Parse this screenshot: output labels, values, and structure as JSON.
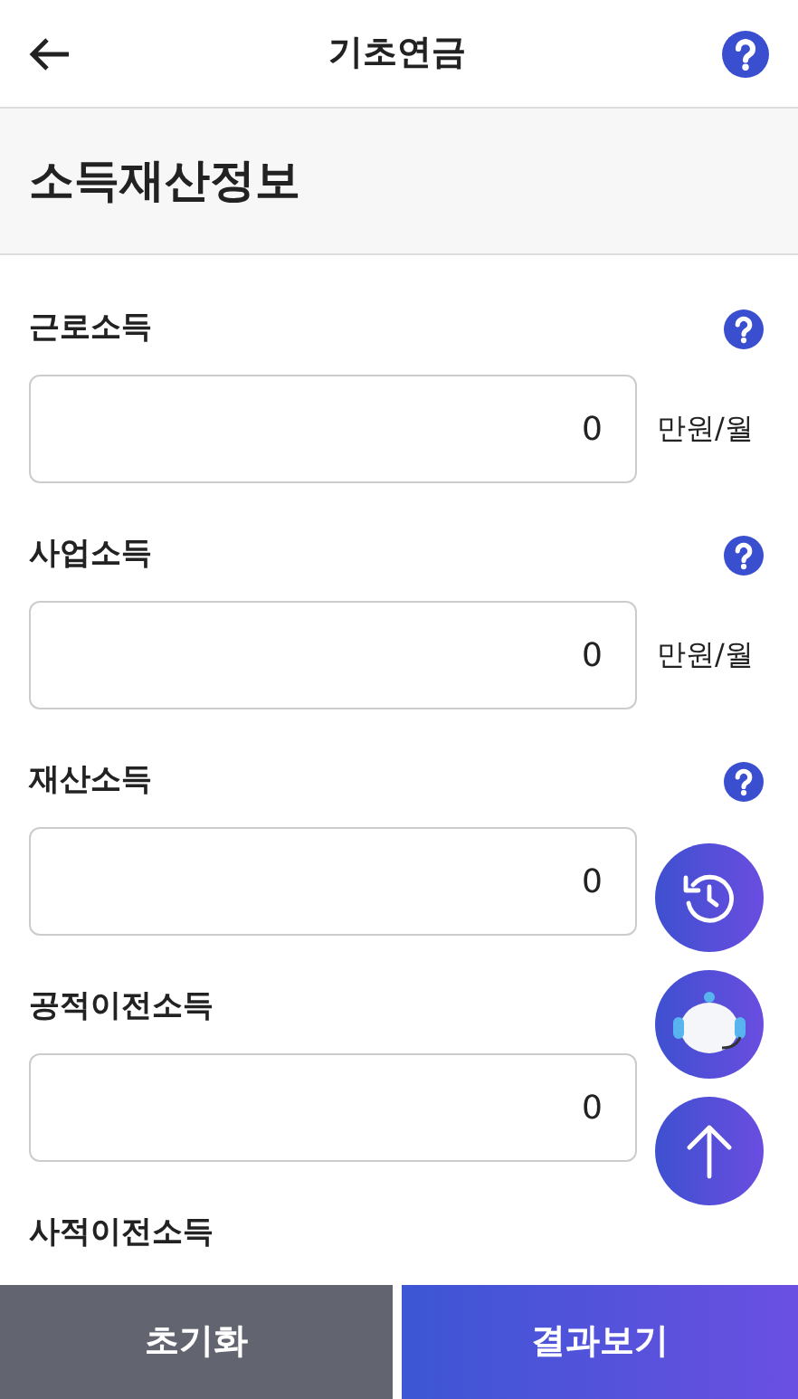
{
  "header": {
    "title": "기초연금",
    "help": true
  },
  "section_title": "소득재산정보",
  "fields": [
    {
      "label": "근로소득",
      "help": true,
      "value": "0",
      "unit": "만원/월"
    },
    {
      "label": "사업소득",
      "help": true,
      "value": "0",
      "unit": "만원/월"
    },
    {
      "label": "재산소득",
      "help": true,
      "value": "0"
    },
    {
      "label": "공적이전소득",
      "help": false,
      "value": "0"
    },
    {
      "label": "사적이전소득",
      "help": false
    }
  ],
  "floating_buttons": [
    {
      "kind": "history"
    },
    {
      "kind": "chatbot"
    },
    {
      "kind": "top"
    }
  ],
  "buttons": [
    {
      "label": "초기화",
      "kind": "reset"
    },
    {
      "label": "결과보기",
      "kind": "primary"
    }
  ]
}
